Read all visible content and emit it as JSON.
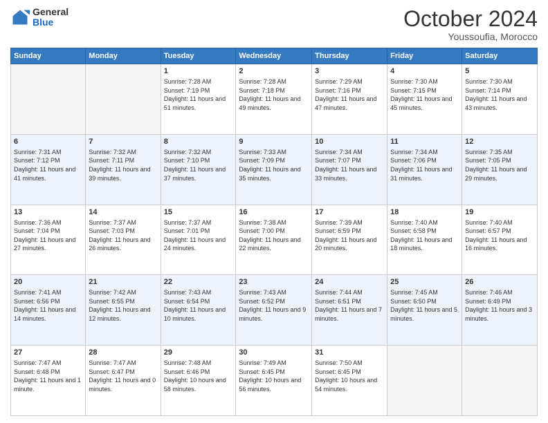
{
  "header": {
    "logo_general": "General",
    "logo_blue": "Blue",
    "month": "October 2024",
    "location": "Youssoufia, Morocco"
  },
  "weekdays": [
    "Sunday",
    "Monday",
    "Tuesday",
    "Wednesday",
    "Thursday",
    "Friday",
    "Saturday"
  ],
  "weeks": [
    [
      {
        "day": "",
        "info": ""
      },
      {
        "day": "",
        "info": ""
      },
      {
        "day": "1",
        "info": "Sunrise: 7:28 AM\nSunset: 7:19 PM\nDaylight: 11 hours and 51 minutes."
      },
      {
        "day": "2",
        "info": "Sunrise: 7:28 AM\nSunset: 7:18 PM\nDaylight: 11 hours and 49 minutes."
      },
      {
        "day": "3",
        "info": "Sunrise: 7:29 AM\nSunset: 7:16 PM\nDaylight: 11 hours and 47 minutes."
      },
      {
        "day": "4",
        "info": "Sunrise: 7:30 AM\nSunset: 7:15 PM\nDaylight: 11 hours and 45 minutes."
      },
      {
        "day": "5",
        "info": "Sunrise: 7:30 AM\nSunset: 7:14 PM\nDaylight: 11 hours and 43 minutes."
      }
    ],
    [
      {
        "day": "6",
        "info": "Sunrise: 7:31 AM\nSunset: 7:12 PM\nDaylight: 11 hours and 41 minutes."
      },
      {
        "day": "7",
        "info": "Sunrise: 7:32 AM\nSunset: 7:11 PM\nDaylight: 11 hours and 39 minutes."
      },
      {
        "day": "8",
        "info": "Sunrise: 7:32 AM\nSunset: 7:10 PM\nDaylight: 11 hours and 37 minutes."
      },
      {
        "day": "9",
        "info": "Sunrise: 7:33 AM\nSunset: 7:09 PM\nDaylight: 11 hours and 35 minutes."
      },
      {
        "day": "10",
        "info": "Sunrise: 7:34 AM\nSunset: 7:07 PM\nDaylight: 11 hours and 33 minutes."
      },
      {
        "day": "11",
        "info": "Sunrise: 7:34 AM\nSunset: 7:06 PM\nDaylight: 11 hours and 31 minutes."
      },
      {
        "day": "12",
        "info": "Sunrise: 7:35 AM\nSunset: 7:05 PM\nDaylight: 11 hours and 29 minutes."
      }
    ],
    [
      {
        "day": "13",
        "info": "Sunrise: 7:36 AM\nSunset: 7:04 PM\nDaylight: 11 hours and 27 minutes."
      },
      {
        "day": "14",
        "info": "Sunrise: 7:37 AM\nSunset: 7:03 PM\nDaylight: 11 hours and 26 minutes."
      },
      {
        "day": "15",
        "info": "Sunrise: 7:37 AM\nSunset: 7:01 PM\nDaylight: 11 hours and 24 minutes."
      },
      {
        "day": "16",
        "info": "Sunrise: 7:38 AM\nSunset: 7:00 PM\nDaylight: 11 hours and 22 minutes."
      },
      {
        "day": "17",
        "info": "Sunrise: 7:39 AM\nSunset: 6:59 PM\nDaylight: 11 hours and 20 minutes."
      },
      {
        "day": "18",
        "info": "Sunrise: 7:40 AM\nSunset: 6:58 PM\nDaylight: 11 hours and 18 minutes."
      },
      {
        "day": "19",
        "info": "Sunrise: 7:40 AM\nSunset: 6:57 PM\nDaylight: 11 hours and 16 minutes."
      }
    ],
    [
      {
        "day": "20",
        "info": "Sunrise: 7:41 AM\nSunset: 6:56 PM\nDaylight: 11 hours and 14 minutes."
      },
      {
        "day": "21",
        "info": "Sunrise: 7:42 AM\nSunset: 6:55 PM\nDaylight: 11 hours and 12 minutes."
      },
      {
        "day": "22",
        "info": "Sunrise: 7:43 AM\nSunset: 6:54 PM\nDaylight: 11 hours and 10 minutes."
      },
      {
        "day": "23",
        "info": "Sunrise: 7:43 AM\nSunset: 6:52 PM\nDaylight: 11 hours and 9 minutes."
      },
      {
        "day": "24",
        "info": "Sunrise: 7:44 AM\nSunset: 6:51 PM\nDaylight: 11 hours and 7 minutes."
      },
      {
        "day": "25",
        "info": "Sunrise: 7:45 AM\nSunset: 6:50 PM\nDaylight: 11 hours and 5 minutes."
      },
      {
        "day": "26",
        "info": "Sunrise: 7:46 AM\nSunset: 6:49 PM\nDaylight: 11 hours and 3 minutes."
      }
    ],
    [
      {
        "day": "27",
        "info": "Sunrise: 7:47 AM\nSunset: 6:48 PM\nDaylight: 11 hours and 1 minute."
      },
      {
        "day": "28",
        "info": "Sunrise: 7:47 AM\nSunset: 6:47 PM\nDaylight: 11 hours and 0 minutes."
      },
      {
        "day": "29",
        "info": "Sunrise: 7:48 AM\nSunset: 6:46 PM\nDaylight: 10 hours and 58 minutes."
      },
      {
        "day": "30",
        "info": "Sunrise: 7:49 AM\nSunset: 6:45 PM\nDaylight: 10 hours and 56 minutes."
      },
      {
        "day": "31",
        "info": "Sunrise: 7:50 AM\nSunset: 6:45 PM\nDaylight: 10 hours and 54 minutes."
      },
      {
        "day": "",
        "info": ""
      },
      {
        "day": "",
        "info": ""
      }
    ]
  ]
}
